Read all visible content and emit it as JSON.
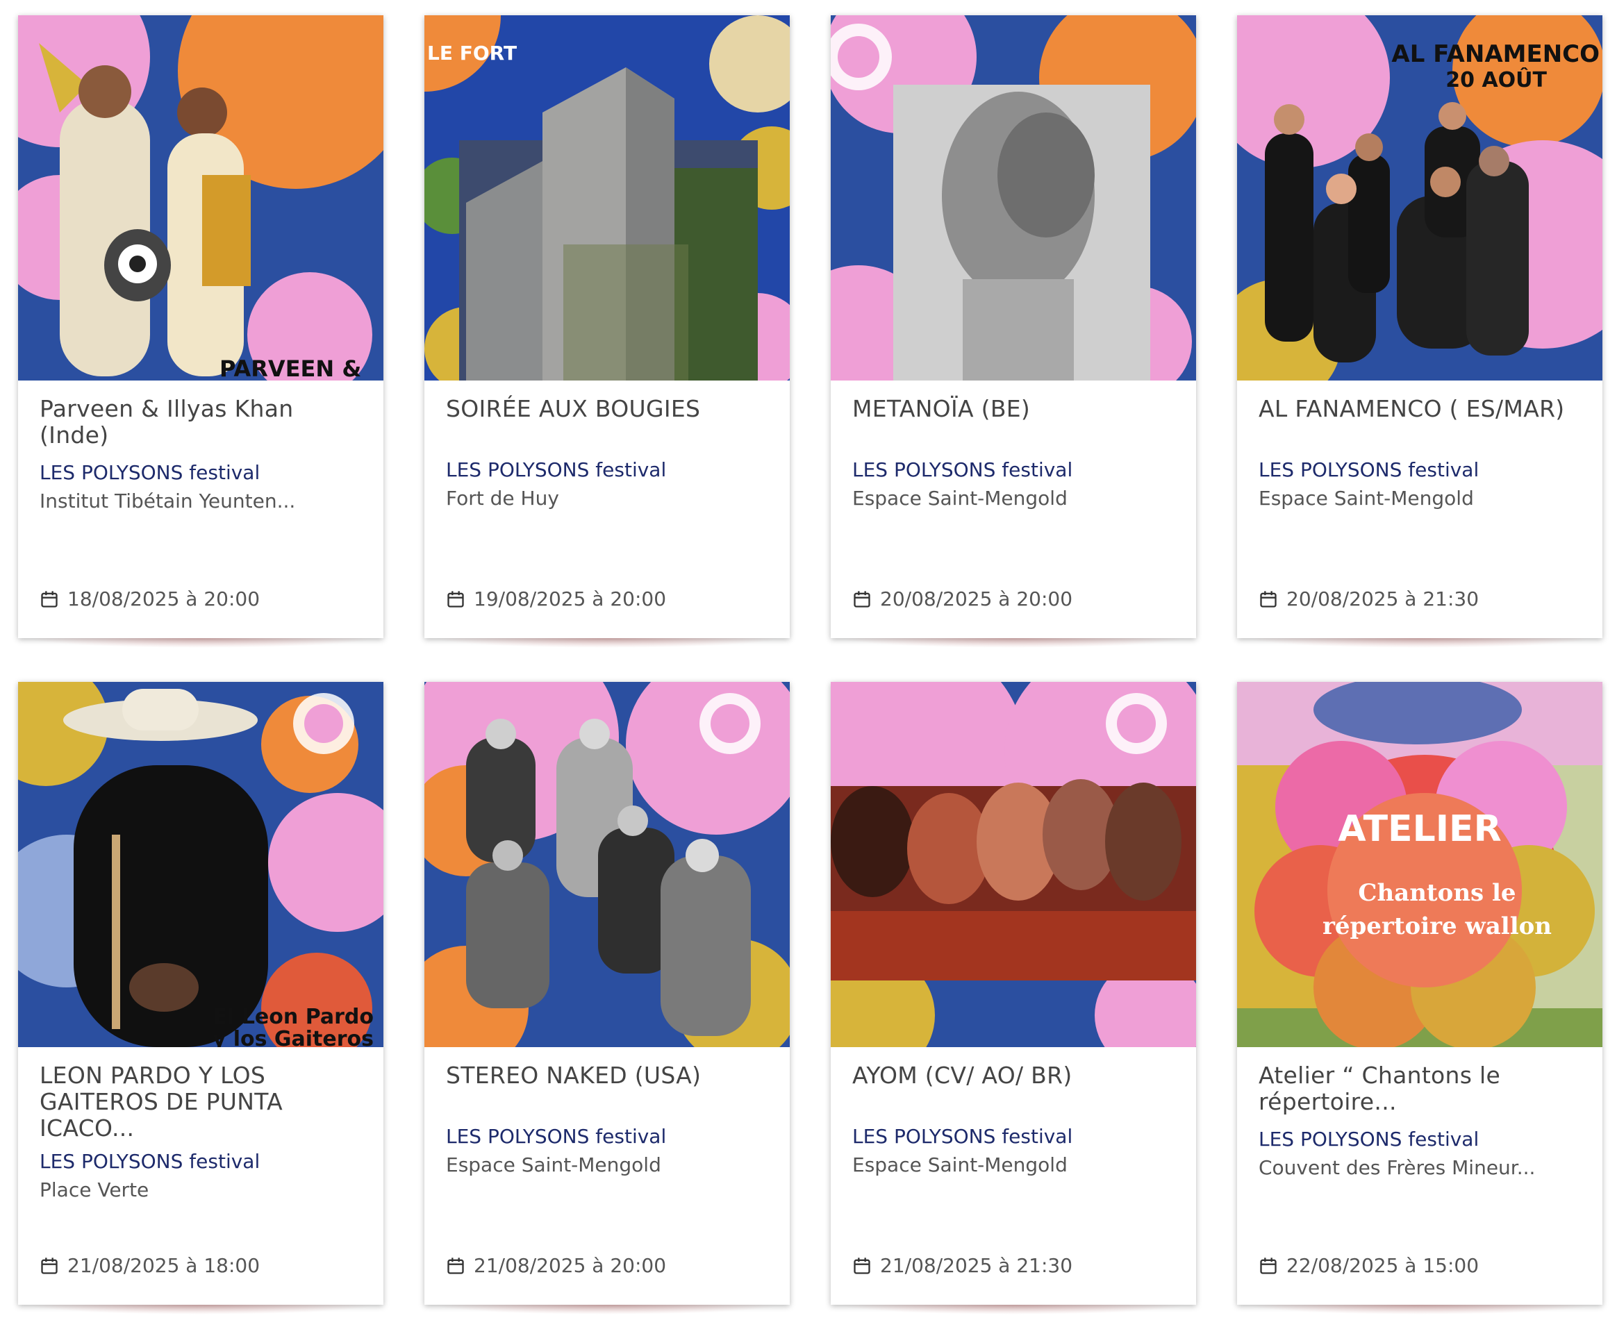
{
  "organizer_label": "LES POLYSONS festival",
  "cards": [
    {
      "title": "Parveen & Illyas Khan (Inde)",
      "venue": "Institut Tibétain Yeunten...",
      "date": "18/08/2025 à 20:00",
      "image_text": "PARVEEN &"
    },
    {
      "title": "SOIRÉE AUX BOUGIES",
      "venue": "Fort de Huy",
      "date": "19/08/2025 à 20:00",
      "image_text": "LE FORT"
    },
    {
      "title": "METANOÏA (BE)",
      "venue": "Espace Saint-Mengold",
      "date": "20/08/2025 à 20:00",
      "image_text": ""
    },
    {
      "title": "AL FANAMENCO ( ES/MAR)",
      "venue": "Espace Saint-Mengold",
      "date": "20/08/2025 à 21:30",
      "image_text": "AL FANAMENCO",
      "image_subtext": "20 AOÛT"
    },
    {
      "title": "LEON PARDO Y LOS GAITEROS DE PUNTA ICACO...",
      "venue": "Place Verte",
      "date": "21/08/2025 à 18:00",
      "image_text": "El Leon Pardo",
      "image_subtext": "y los Gaiteros"
    },
    {
      "title": "STEREO NAKED (USA)",
      "venue": "Espace Saint-Mengold",
      "date": "21/08/2025 à 20:00",
      "image_text": ""
    },
    {
      "title": "AYOM (CV/ AO/ BR)",
      "venue": "Espace Saint-Mengold",
      "date": "21/08/2025 à 21:30",
      "image_text": ""
    },
    {
      "title": "Atelier “ Chantons le répertoire...",
      "venue": "Couvent des Frères Mineur...",
      "date": "22/08/2025 à 15:00",
      "image_text": "ATELIER",
      "image_subtext": "Chantons le répertoire wallon"
    }
  ],
  "colors": {
    "organizer": "#1d2a6b",
    "title": "#444444",
    "poster_blue": "#2b4fa0",
    "poster_pink": "#ef9fd6",
    "poster_orange": "#ef8a3a",
    "poster_yellow": "#d7b43a"
  },
  "icons": {
    "date": "calendar-icon"
  }
}
